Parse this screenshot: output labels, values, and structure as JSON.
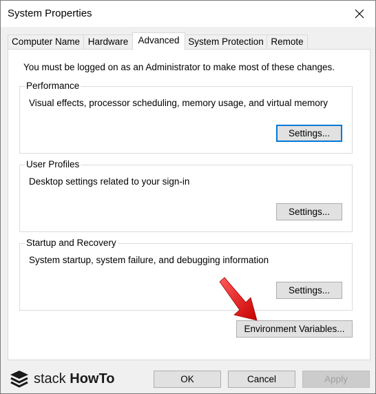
{
  "window": {
    "title": "System Properties",
    "close_icon": "close-icon"
  },
  "tabs": [
    {
      "label": "Computer Name"
    },
    {
      "label": "Hardware"
    },
    {
      "label": "Advanced",
      "active": true
    },
    {
      "label": "System Protection"
    },
    {
      "label": "Remote"
    }
  ],
  "panel": {
    "admin_note": "You must be logged on as an Administrator to make most of these changes.",
    "performance": {
      "title": "Performance",
      "description": "Visual effects, processor scheduling, memory usage, and virtual memory",
      "button": "Settings..."
    },
    "user_profiles": {
      "title": "User Profiles",
      "description": "Desktop settings related to your sign-in",
      "button": "Settings..."
    },
    "startup_recovery": {
      "title": "Startup and Recovery",
      "description": "System startup, system failure, and debugging information",
      "button": "Settings..."
    },
    "env_button": "Environment Variables..."
  },
  "footer": {
    "logo_brand": "stack",
    "logo_brand_bold": "HowTo",
    "ok": "OK",
    "cancel": "Cancel",
    "apply": "Apply"
  },
  "colors": {
    "accent": "#0078d7",
    "arrow": "#e00000"
  }
}
